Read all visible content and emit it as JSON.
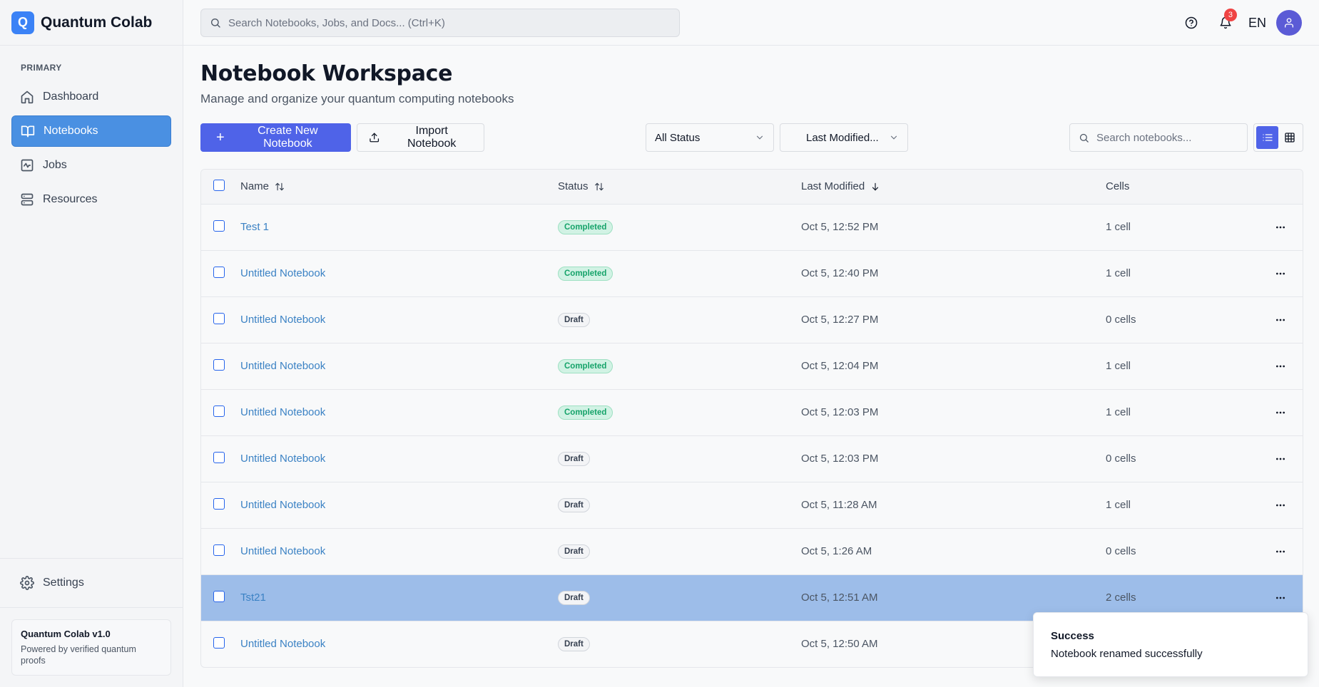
{
  "app": {
    "logo_letter": "Q",
    "name": "Quantum Colab"
  },
  "sidebar": {
    "section_label": "PRIMARY",
    "items": [
      {
        "label": "Dashboard",
        "icon": "home-icon"
      },
      {
        "label": "Notebooks",
        "icon": "book-open-icon",
        "active": true
      },
      {
        "label": "Jobs",
        "icon": "activity-icon"
      },
      {
        "label": "Resources",
        "icon": "server-icon"
      }
    ],
    "settings_label": "Settings",
    "version_title": "Quantum Colab v1.0",
    "version_sub": "Powered by verified quantum proofs"
  },
  "topbar": {
    "search_placeholder": "Search Notebooks, Jobs, and Docs... (Ctrl+K)",
    "notification_count": "3",
    "language": "EN"
  },
  "page": {
    "title": "Notebook Workspace",
    "subtitle": "Manage and organize your quantum computing notebooks"
  },
  "toolbar": {
    "create_label": "Create New Notebook",
    "import_label": "Import Notebook",
    "status_filter": "All Status",
    "sort_value": "Last Modified...",
    "search_placeholder": "Search notebooks..."
  },
  "table": {
    "columns": [
      "Name",
      "Status",
      "Last Modified",
      "Cells"
    ],
    "rows": [
      {
        "name": "Test 1",
        "status": "Completed",
        "modified": "Oct 5, 12:52 PM",
        "cells": "1 cell"
      },
      {
        "name": "Untitled Notebook",
        "status": "Completed",
        "modified": "Oct 5, 12:40 PM",
        "cells": "1 cell"
      },
      {
        "name": "Untitled Notebook",
        "status": "Draft",
        "modified": "Oct 5, 12:27 PM",
        "cells": "0 cells"
      },
      {
        "name": "Untitled Notebook",
        "status": "Completed",
        "modified": "Oct 5, 12:04 PM",
        "cells": "1 cell"
      },
      {
        "name": "Untitled Notebook",
        "status": "Completed",
        "modified": "Oct 5, 12:03 PM",
        "cells": "1 cell"
      },
      {
        "name": "Untitled Notebook",
        "status": "Draft",
        "modified": "Oct 5, 12:03 PM",
        "cells": "0 cells"
      },
      {
        "name": "Untitled Notebook",
        "status": "Draft",
        "modified": "Oct 5, 11:28 AM",
        "cells": "1 cell"
      },
      {
        "name": "Untitled Notebook",
        "status": "Draft",
        "modified": "Oct 5, 1:26 AM",
        "cells": "0 cells"
      },
      {
        "name": "Tst21",
        "status": "Draft",
        "modified": "Oct 5, 12:51 AM",
        "cells": "2 cells",
        "selected": true
      },
      {
        "name": "Untitled Notebook",
        "status": "Draft",
        "modified": "Oct 5, 12:50 AM",
        "cells": ""
      }
    ]
  },
  "toast": {
    "title": "Success",
    "message": "Notebook renamed successfully"
  },
  "colors": {
    "accent": "#4f63e8",
    "nav_active": "#4a90e2",
    "selected_row": "#9dbde9",
    "badge_red": "#ef4444"
  }
}
